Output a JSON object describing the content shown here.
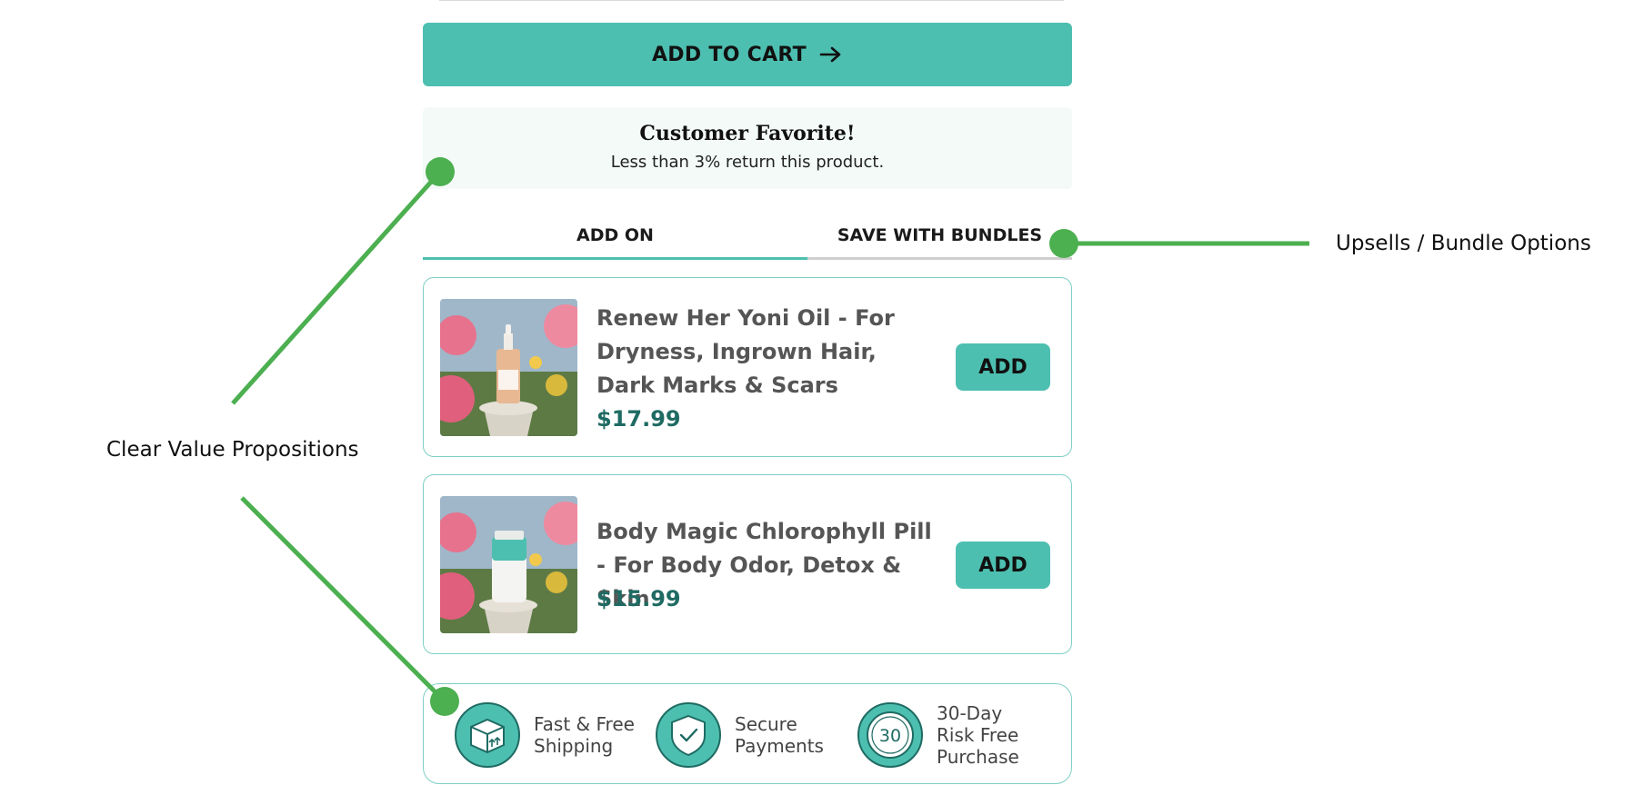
{
  "cart": {
    "label": "ADD TO CART"
  },
  "favorite": {
    "title": "Customer Favorite!",
    "subtitle": "Less than 3% return this product."
  },
  "tabs": [
    {
      "label": "ADD ON",
      "active": true
    },
    {
      "label": "SAVE WITH BUNDLES",
      "active": false
    }
  ],
  "products": [
    {
      "name": "Renew Her Yoni Oil - For Dryness, Ingrown Hair, Dark Marks & Scars",
      "price": "$17.99",
      "add_label": "ADD"
    },
    {
      "name": "Body Magic Chlorophyll Pill - For Body Odor, Detox & Skin",
      "price": "$15.99",
      "add_label": "ADD"
    }
  ],
  "trust": [
    {
      "line1": "Fast & Free",
      "line2": "Shipping",
      "line3": "",
      "icon": "shipping-box-icon"
    },
    {
      "line1": "Secure",
      "line2": "Payments",
      "line3": "",
      "icon": "shield-check-icon"
    },
    {
      "line1": "30-Day",
      "line2": "Risk Free",
      "line3": "Purchase",
      "icon": "30-day-icon"
    }
  ],
  "annotations": {
    "clear_value": "Clear Value Propositions",
    "upsells": "Upsells / Bundle Options"
  },
  "colors": {
    "accent": "#4dbfb0",
    "price": "#1f6b63",
    "annotation": "#4caf50",
    "border": "#7ecfc4"
  }
}
